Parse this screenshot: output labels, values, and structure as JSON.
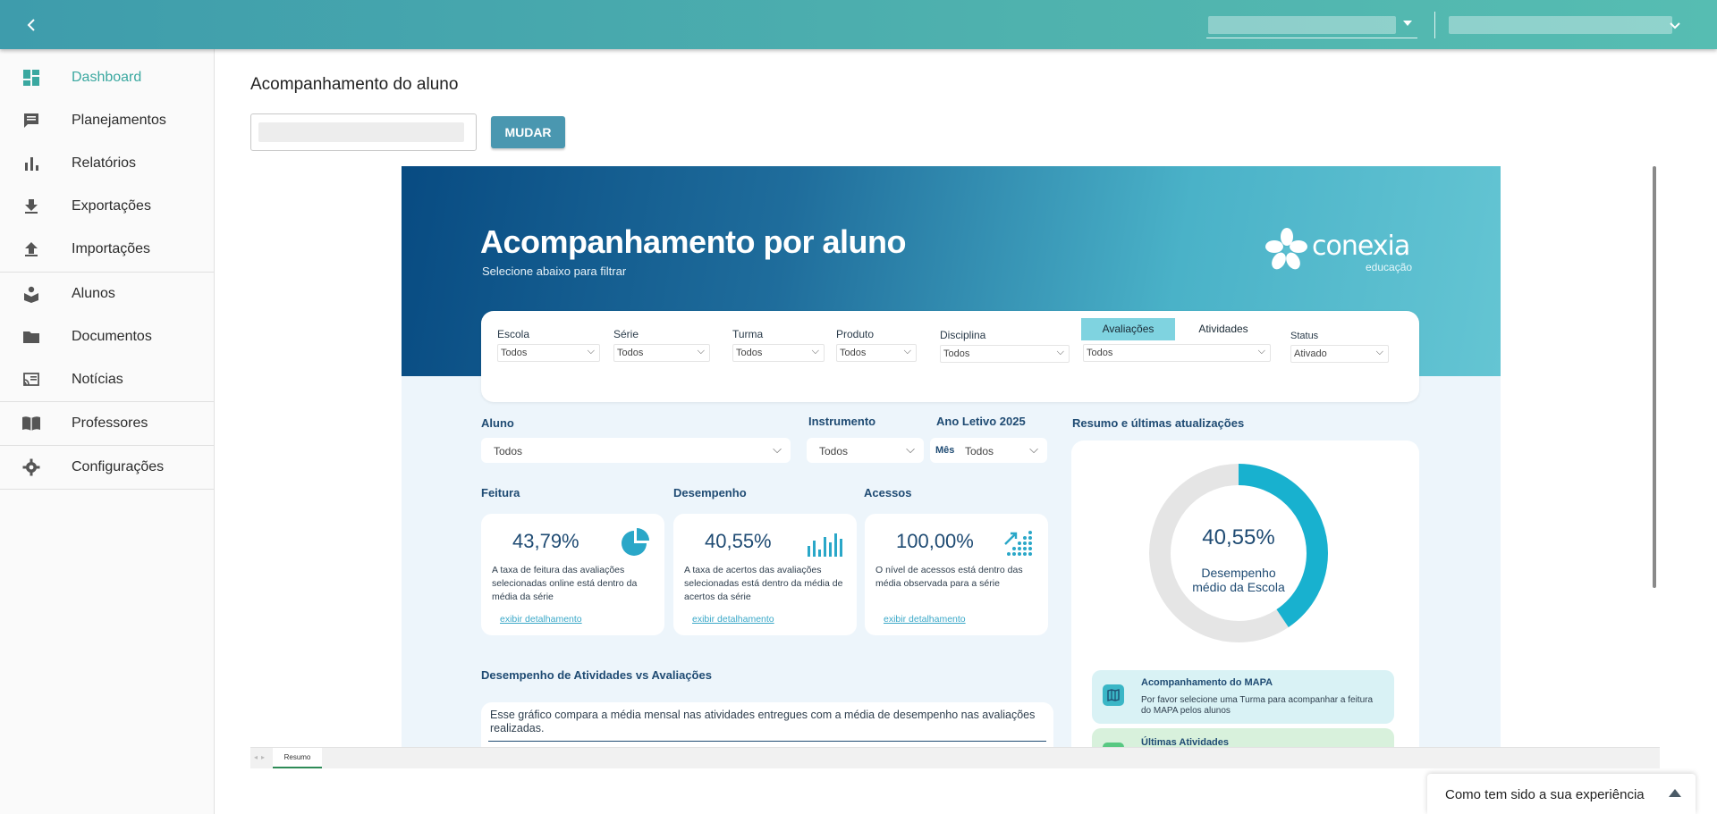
{
  "topbar": {
    "back_icon": "chevron-left-icon",
    "select1_value": "",
    "select2_value": ""
  },
  "sidebar": {
    "items": [
      {
        "label": "Dashboard",
        "icon": "dashboard-icon",
        "active": true
      },
      {
        "label": "Planejamentos",
        "icon": "chat-icon"
      },
      {
        "label": "Relatórios",
        "icon": "bar-chart-icon"
      },
      {
        "label": "Exportações",
        "icon": "download-icon"
      },
      {
        "label": "Importações",
        "icon": "upload-icon"
      },
      {
        "label": "Alunos",
        "icon": "school-icon"
      },
      {
        "label": "Documentos",
        "icon": "folder-icon"
      },
      {
        "label": "Notícias",
        "icon": "cast-icon"
      },
      {
        "label": "Professores",
        "icon": "book-icon"
      },
      {
        "label": "Configurações",
        "icon": "gear-icon"
      }
    ]
  },
  "main": {
    "page_title": "Acompanhamento do aluno",
    "student_input_value": "",
    "change_button": "MUDAR"
  },
  "report": {
    "title": "Acompanhamento por aluno",
    "subtitle": "Selecione abaixo para filtrar",
    "logo_text": "conexia",
    "logo_sub": "educação",
    "filters": {
      "escola": {
        "label": "Escola",
        "value": "Todos"
      },
      "serie": {
        "label": "Série",
        "value": "Todos"
      },
      "turma": {
        "label": "Turma",
        "value": "Todos"
      },
      "produto": {
        "label": "Produto",
        "value": "Todos"
      },
      "disciplina": {
        "label": "Disciplina",
        "value": "Todos"
      },
      "tab_avaliacoes": "Avaliações",
      "tab_atividades": "Atividades",
      "tipo_value": "Todos",
      "status": {
        "label": "Status",
        "value": "Ativado"
      }
    },
    "aluno": {
      "label": "Aluno",
      "value": "Todos"
    },
    "instrumento": {
      "label": "Instrumento",
      "value": "Todos"
    },
    "ano_letivo": {
      "label": "Ano Letivo 2025",
      "mes_label": "Mês",
      "value": "Todos"
    },
    "resumo_label": "Resumo e últimas atualizações",
    "kpis": {
      "feitura": {
        "label": "Feitura",
        "value": "43,79%",
        "desc": "A taxa de feitura das avaliações selecionadas online está dentro da média da série",
        "link": "exibir detalhamento",
        "icon": "pie-chart-icon"
      },
      "desempenho": {
        "label": "Desempenho",
        "value": "40,55%",
        "desc": "A taxa de acertos das avaliações selecionadas está dentro da média de acertos da série",
        "link": "exibir detalhamento",
        "icon": "bar-chart-icon"
      },
      "acessos": {
        "label": "Acessos",
        "value": "100,00%",
        "desc": "O nível de acessos está dentro das média observada para a série",
        "link": "exibir detalhamento",
        "icon": "growth-icon"
      }
    },
    "donut": {
      "value": "40,55%",
      "label_line1": "Desempenho",
      "label_line2": "médio da Escola",
      "fraction": 0.4055,
      "color": "#18b1cf",
      "track_color": "#e5e5e5"
    },
    "mapa": {
      "title": "Acompanhamento do MAPA",
      "desc": "Por favor selecione uma Turma para acompanhar a feitura do MAPA pelos alunos",
      "icon": "map-icon"
    },
    "ultimas": {
      "title": "Últimas Atividades"
    },
    "chart_section": {
      "title": "Desempenho de Atividades vs Avaliações",
      "desc": "Esse gráfico compara a média mensal nas atividades entregues com a média de desempenho nas avaliações realizadas."
    }
  },
  "sheets": {
    "active": "Resumo"
  },
  "feedback": {
    "text": "Como tem sido a sua experiência"
  },
  "colors": {
    "topbar": "#4fb2ae",
    "accent": "#3aa8a0",
    "button": "#4a97b0",
    "hero_dark": "#084b82",
    "hero_light": "#64c5d3",
    "navy": "#1f4b73"
  }
}
